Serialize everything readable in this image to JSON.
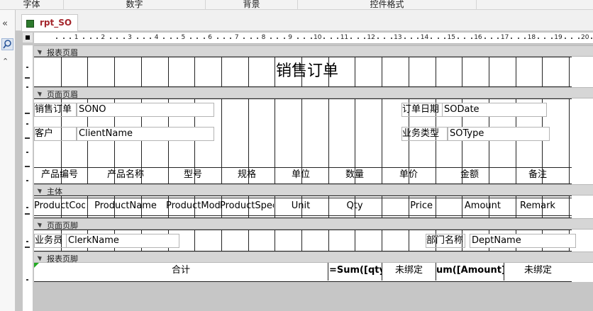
{
  "ribbon": {
    "groups": [
      "字体",
      "数字",
      "背景",
      "控件格式"
    ]
  },
  "navigation": {
    "collapse_glyph": "«",
    "search_icon": "search-icon",
    "expand_glyph": "⌃"
  },
  "tab": {
    "label": "rpt_SO",
    "icon": "report-icon"
  },
  "ruler": {
    "labels": [
      "1",
      "2",
      "3",
      "4",
      "5",
      "6",
      "7",
      "8",
      "9",
      "10",
      "11",
      "12",
      "13",
      "14",
      "15",
      "16",
      "17",
      "18",
      "19",
      "20"
    ]
  },
  "sections": {
    "report_header": "报表页眉",
    "page_header": "页面页眉",
    "detail": "主体",
    "page_footer": "页面页脚",
    "report_footer": "报表页脚"
  },
  "report_header": {
    "title": "销售订单"
  },
  "page_header": {
    "so_label": "销售订单",
    "so_field": "SONO",
    "date_label": "订单日期",
    "date_field": "SODate",
    "client_label": "客户",
    "client_field": "ClientName",
    "type_label": "业务类型",
    "type_field": "SOType",
    "columns": [
      "产品编号",
      "产品名称",
      "型号",
      "规格",
      "单位",
      "数量",
      "单价",
      "金额",
      "备注"
    ]
  },
  "detail": {
    "fields": [
      "ProductCod",
      "ProductName",
      "ProductMode",
      "ProductSpec",
      "Unit",
      "Qty",
      "Price",
      "Amount",
      "Remark"
    ]
  },
  "page_footer": {
    "clerk_label": "业务员",
    "clerk_field": "ClerkName",
    "dept_label": "部门名称",
    "dept_field": "DeptName"
  },
  "report_footer": {
    "total_label": "合计",
    "sum_qty": "=Sum([qty]",
    "unbound1": "未绑定",
    "sum_amount": "um([Amount])",
    "unbound2": "未绑定"
  },
  "colors": {
    "tab_text": "#a4262c",
    "band_bg": "#d6d6d6",
    "canvas_bg": "#c6c6c6"
  }
}
